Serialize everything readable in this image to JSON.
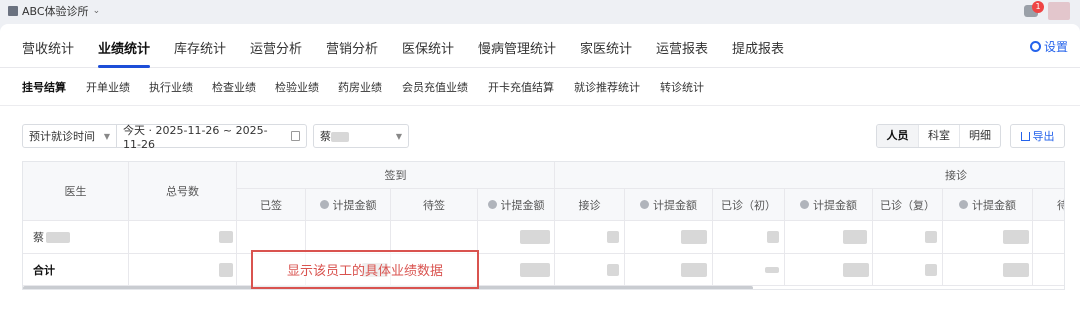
{
  "clinic": {
    "name": "ABC体验诊所"
  },
  "notification": {
    "count": "1"
  },
  "nav": {
    "tabs": [
      "营收统计",
      "业绩统计",
      "库存统计",
      "运营分析",
      "营销分析",
      "医保统计",
      "慢病管理统计",
      "家医统计",
      "运营报表",
      "提成报表"
    ],
    "active": "业绩统计",
    "settings_label": "设置"
  },
  "subnav": {
    "items": [
      "挂号结算",
      "开单业绩",
      "执行业绩",
      "检查业绩",
      "检验业绩",
      "药房业绩",
      "会员充值业绩",
      "开卡充值结算",
      "就诊推荐统计",
      "转诊统计"
    ],
    "active": "挂号结算"
  },
  "filters": {
    "time_type": "预计就诊时间",
    "date_range": "今天 · 2025-11-26  ~  2025-11-26",
    "doctor_prefix": "蔡"
  },
  "view_toggle": {
    "options": [
      "人员",
      "科室",
      "明细"
    ],
    "selected": "人员"
  },
  "export_label": "导出",
  "table": {
    "group_signed": "签到",
    "group_reception": "接诊",
    "col_doctor": "医生",
    "col_total": "总号数",
    "sub_cols": [
      "已签",
      "计提金额",
      "待签",
      "计提金额",
      "接诊",
      "计提金额",
      "已诊（初）",
      "计提金额",
      "已诊（复）",
      "计提金额",
      "待"
    ],
    "rows": [
      {
        "name": "蔡"
      },
      {
        "name": "合计"
      }
    ]
  },
  "annotation": {
    "text": "显示该员工的具体业绩数据",
    "color": "#d9534f"
  },
  "colors": {
    "accent": "#1d4ed8",
    "link": "#2563eb"
  }
}
